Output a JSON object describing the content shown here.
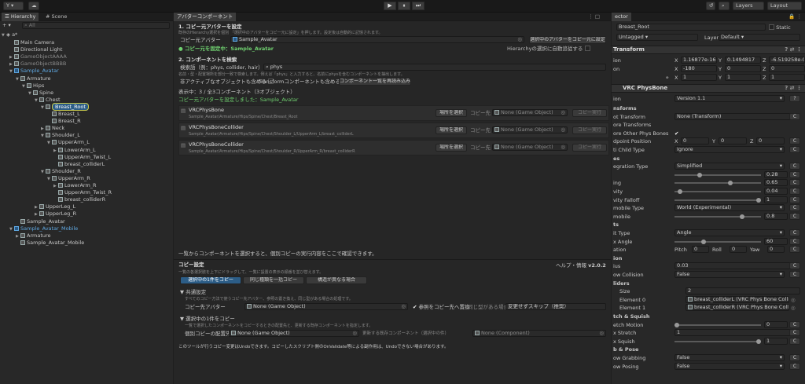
{
  "toolbar": {
    "account": "Y ▾",
    "layers": "Layers",
    "layout": "Layout",
    "play": "▶",
    "pause": "⏸",
    "step": "⏭"
  },
  "hierarchy": {
    "tab": "Hierarchy",
    "scene_tab": "Scene",
    "search_placeholder": "All",
    "add": "+ ▾",
    "scene_name": "a*",
    "items": [
      {
        "label": "Main Camera",
        "indent": 1,
        "arrow": "",
        "style": "normal"
      },
      {
        "label": "Directional Light",
        "indent": 1,
        "arrow": "",
        "style": "normal"
      },
      {
        "label": "GameObjectAAAA",
        "indent": 1,
        "arrow": "▶",
        "style": "dim"
      },
      {
        "label": "GameObjectBBBB",
        "indent": 1,
        "arrow": "▶",
        "style": "dim"
      },
      {
        "label": "Sample_Avatar",
        "indent": 1,
        "arrow": "▼",
        "style": "prefab"
      },
      {
        "label": "Armature",
        "indent": 2,
        "arrow": "▼",
        "style": "normal"
      },
      {
        "label": "Hips",
        "indent": 3,
        "arrow": "▼",
        "style": "normal"
      },
      {
        "label": "Spine",
        "indent": 4,
        "arrow": "▼",
        "style": "normal"
      },
      {
        "label": "Chest",
        "indent": 5,
        "arrow": "▼",
        "style": "normal"
      },
      {
        "label": "Breast_Root",
        "indent": 6,
        "arrow": "▼",
        "style": "selected"
      },
      {
        "label": "Breast_L",
        "indent": 7,
        "arrow": "",
        "style": "normal"
      },
      {
        "label": "Breast_R",
        "indent": 7,
        "arrow": "",
        "style": "normal"
      },
      {
        "label": "Neck",
        "indent": 6,
        "arrow": "▶",
        "style": "normal"
      },
      {
        "label": "Shoulder_L",
        "indent": 6,
        "arrow": "▼",
        "style": "normal"
      },
      {
        "label": "UpperArm_L",
        "indent": 7,
        "arrow": "▼",
        "style": "normal"
      },
      {
        "label": "LowerArm_L",
        "indent": 8,
        "arrow": "▶",
        "style": "normal"
      },
      {
        "label": "UpperArm_Twist_L",
        "indent": 8,
        "arrow": "",
        "style": "normal"
      },
      {
        "label": "breast_colliderL",
        "indent": 8,
        "arrow": "",
        "style": "normal"
      },
      {
        "label": "Shoulder_R",
        "indent": 6,
        "arrow": "▼",
        "style": "normal"
      },
      {
        "label": "UpperArm_R",
        "indent": 7,
        "arrow": "▼",
        "style": "normal"
      },
      {
        "label": "LowerArm_R",
        "indent": 8,
        "arrow": "▶",
        "style": "normal"
      },
      {
        "label": "UpperArm_Twist_R",
        "indent": 8,
        "arrow": "",
        "style": "normal"
      },
      {
        "label": "breast_colliderR",
        "indent": 8,
        "arrow": "",
        "style": "normal"
      },
      {
        "label": "UpperLeg_L",
        "indent": 5,
        "arrow": "▶",
        "style": "normal"
      },
      {
        "label": "UpperLeg_R",
        "indent": 5,
        "arrow": "▶",
        "style": "normal"
      },
      {
        "label": "Sample_Avatar",
        "indent": 2,
        "arrow": "",
        "style": "normal"
      },
      {
        "label": "Sample_Avatar_Mobile",
        "indent": 1,
        "arrow": "▼",
        "style": "prefab"
      },
      {
        "label": "Armature",
        "indent": 2,
        "arrow": "▶",
        "style": "normal"
      },
      {
        "label": "Sample_Avatar_Mobile",
        "indent": 2,
        "arrow": "",
        "style": "normal"
      }
    ]
  },
  "copier": {
    "tab": "アバターコンポーネント",
    "s1_title": "1. コピー元アバターを設定",
    "s1_desc": "既存のHierarchy選択を個別 「選択中のアバターをコピー元に設定」を押します。設定後は自動的に記憶されます。",
    "src_label": "コピー元アバター",
    "src_value": "Sample_Avatar",
    "set_src_btn": "選択中のアバターをコピー元に設定",
    "fixed_status": "● コピー元を固定中：Sample_Avatar",
    "follow_note": "Hierarchyの選択に自動追従する",
    "s2_title": "2. コンポーネントを検索",
    "search_label": "検索語（例：phys, collider, hair）",
    "search_value": "phys",
    "search_help": "名前・型・配置場所を部分一致で検索します。例えば「phys」と入力すると、名前にphysを含むコンポーネントを抽出します。",
    "inactive_label": "非アクティブなオブジェクトも含める",
    "transform_label": "Transformコンポーネントも含める",
    "research_btn": "コンポーネント一覧を再読み込み",
    "count": "表示中：3 / 全3コンポーネント（3オブジェクト）",
    "set_notice": "コピー元アバターを設定しました：Sample_Avatar",
    "results": [
      {
        "title": "VRCPhysBone",
        "path": "Sample_Avatar/Armature/Hips/Spine/Chest/Breast_Root",
        "btn": "場所を選択",
        "copy_to": "コピー先",
        "target": "None (Game Object)",
        "run": "コピー実行"
      },
      {
        "title": "VRCPhysBoneCollider",
        "path": "Sample_Avatar/Armature/Hips/Spine/Chest/Shoulder_L/UpperArm_L/breast_colliderL",
        "btn": "場所を選択",
        "copy_to": "コピー先",
        "target": "None (Game Object)",
        "run": "コピー実行"
      },
      {
        "title": "VRCPhysBoneCollider",
        "path": "Sample_Avatar/Armature/Hips/Spine/Chest/Shoulder_R/UpperArm_R/breast_colliderR",
        "btn": "場所を選択",
        "copy_to": "コピー先",
        "target": "None (Game Object)",
        "run": "コピー実行"
      }
    ],
    "list_hint": "一覧からコンポーネントを選択すると、個別コピーの実行内容をここで確認できます。",
    "copy_title": "コピー設定",
    "help_label": "ヘルプ・情報",
    "version": "v2.0.2",
    "copy_desc": "一覧の各選択肢を上下にドラッグして、一覧に設置の表示の順番を並び替えます。",
    "mode_tabs": [
      "選択中の1件をコピー",
      "同じ種類を一括コピー",
      "構造が異なる場合"
    ],
    "common_title": "▼ 共通設定",
    "common_desc": "すべてのコピー方法で使うコピー先アバター、参照の置き換え、同じ型がある場合の処理です。",
    "dest_label": "コピー先アバター",
    "dest_value": "None (Game Object)",
    "replace_label": "参照をコピー先へ置換",
    "same_label": "同じ型がある場合",
    "same_value": "変更せずスキップ（推奨）",
    "single_title": "▼ 選択中の1件をコピー",
    "single_desc": "一覧で選択したコンポーネントをコピーするときの配置先と、更新する既存コンポーネントを指定します。",
    "place_label": "個別コピーの配置先",
    "place_value": "None (Game Object)",
    "update_label": "更新する既存コンポーネント（選択中の件）",
    "update_value": "None (Component)",
    "footer": "このツールが行うコピー変更はUndoできます。コピーしたスクリプト側のOnValidate等による副作用は、Undoできない場合があります。"
  },
  "inspector": {
    "tab": "ector",
    "name": "Breast_Root",
    "static": "Static",
    "tag_label": "Tag",
    "tag_value": "Untagged",
    "layer_label": "Layer",
    "layer_value": "Default",
    "transform_title": "Transform",
    "pos_label": "ion",
    "pos": [
      "1.16877e-16",
      "0.1494817",
      "-6.519258e-0"
    ],
    "rot_label": "on",
    "rot": [
      "-180",
      "0",
      "0"
    ],
    "scale": [
      "1",
      "1",
      "1"
    ],
    "physbone_title": "VRC PhysBone",
    "version_label": "ion",
    "version_value": "Version 1.1",
    "props": [
      {
        "label": "nsforms",
        "type": "header"
      },
      {
        "label": "ot Transform",
        "type": "field",
        "value": "None (Transform)"
      },
      {
        "label": "ore Transforms",
        "type": "plain"
      },
      {
        "label": "ore Other Phys Bones",
        "type": "check"
      },
      {
        "label": "dpoint Position",
        "type": "xyz",
        "values": [
          "0",
          "0",
          "0"
        ]
      },
      {
        "label": "ti Child Type",
        "type": "dropdown",
        "value": "Ignore"
      },
      {
        "label": "es",
        "type": "header"
      },
      {
        "label": "egration Type",
        "type": "dropdown",
        "value": "Simplified"
      },
      {
        "label": "",
        "type": "slider",
        "value": "0.28",
        "frac": 0.28
      },
      {
        "label": "ing",
        "type": "slider",
        "value": "0.65",
        "frac": 0.65
      },
      {
        "label": "vity",
        "type": "slider",
        "value": "0.04",
        "frac": 0.04
      },
      {
        "label": "vity Falloff",
        "type": "slider",
        "value": "1",
        "frac": 1
      },
      {
        "label": "mobile Type",
        "type": "dropdown",
        "value": "World (Experimental)"
      },
      {
        "label": "mobile",
        "type": "slider",
        "value": "0.8",
        "frac": 0.8
      },
      {
        "label": "ts",
        "type": "header"
      },
      {
        "label": "it Type",
        "type": "dropdown",
        "value": "Angle"
      },
      {
        "label": "x Angle",
        "type": "slider",
        "value": "60",
        "frac": 0.33
      },
      {
        "label": "ation",
        "type": "pry",
        "values": [
          "0",
          "0",
          "0"
        ]
      },
      {
        "label": "ion",
        "type": "header"
      },
      {
        "label": "ius",
        "type": "field",
        "value": "0.03"
      },
      {
        "label": "ow Collision",
        "type": "dropdown",
        "value": "False"
      },
      {
        "label": "liders",
        "type": "header"
      },
      {
        "label": "Size",
        "type": "size",
        "value": "2"
      },
      {
        "label": "Element 0",
        "type": "obj",
        "value": "breast_colliderL (VRC Phys Bone Collid"
      },
      {
        "label": "Element 1",
        "type": "obj",
        "value": "breast_colliderR (VRC Phys Bone Collid"
      },
      {
        "label": "tch & Squish",
        "type": "header"
      },
      {
        "label": "etch Motion",
        "type": "slider",
        "value": "0",
        "frac": 0
      },
      {
        "label": "x Stretch",
        "type": "field",
        "value": "1"
      },
      {
        "label": "x Squish",
        "type": "slider",
        "value": "1",
        "frac": 1
      },
      {
        "label": "b & Pose",
        "type": "header"
      },
      {
        "label": "ow Grabbing",
        "type": "dropdown",
        "value": "False"
      },
      {
        "label": "ow Posing",
        "type": "dropdown",
        "value": "False"
      }
    ]
  },
  "colors": {
    "accent": "#5fa7e0",
    "selected": "#2c5d87",
    "green": "#6fcf6f"
  }
}
